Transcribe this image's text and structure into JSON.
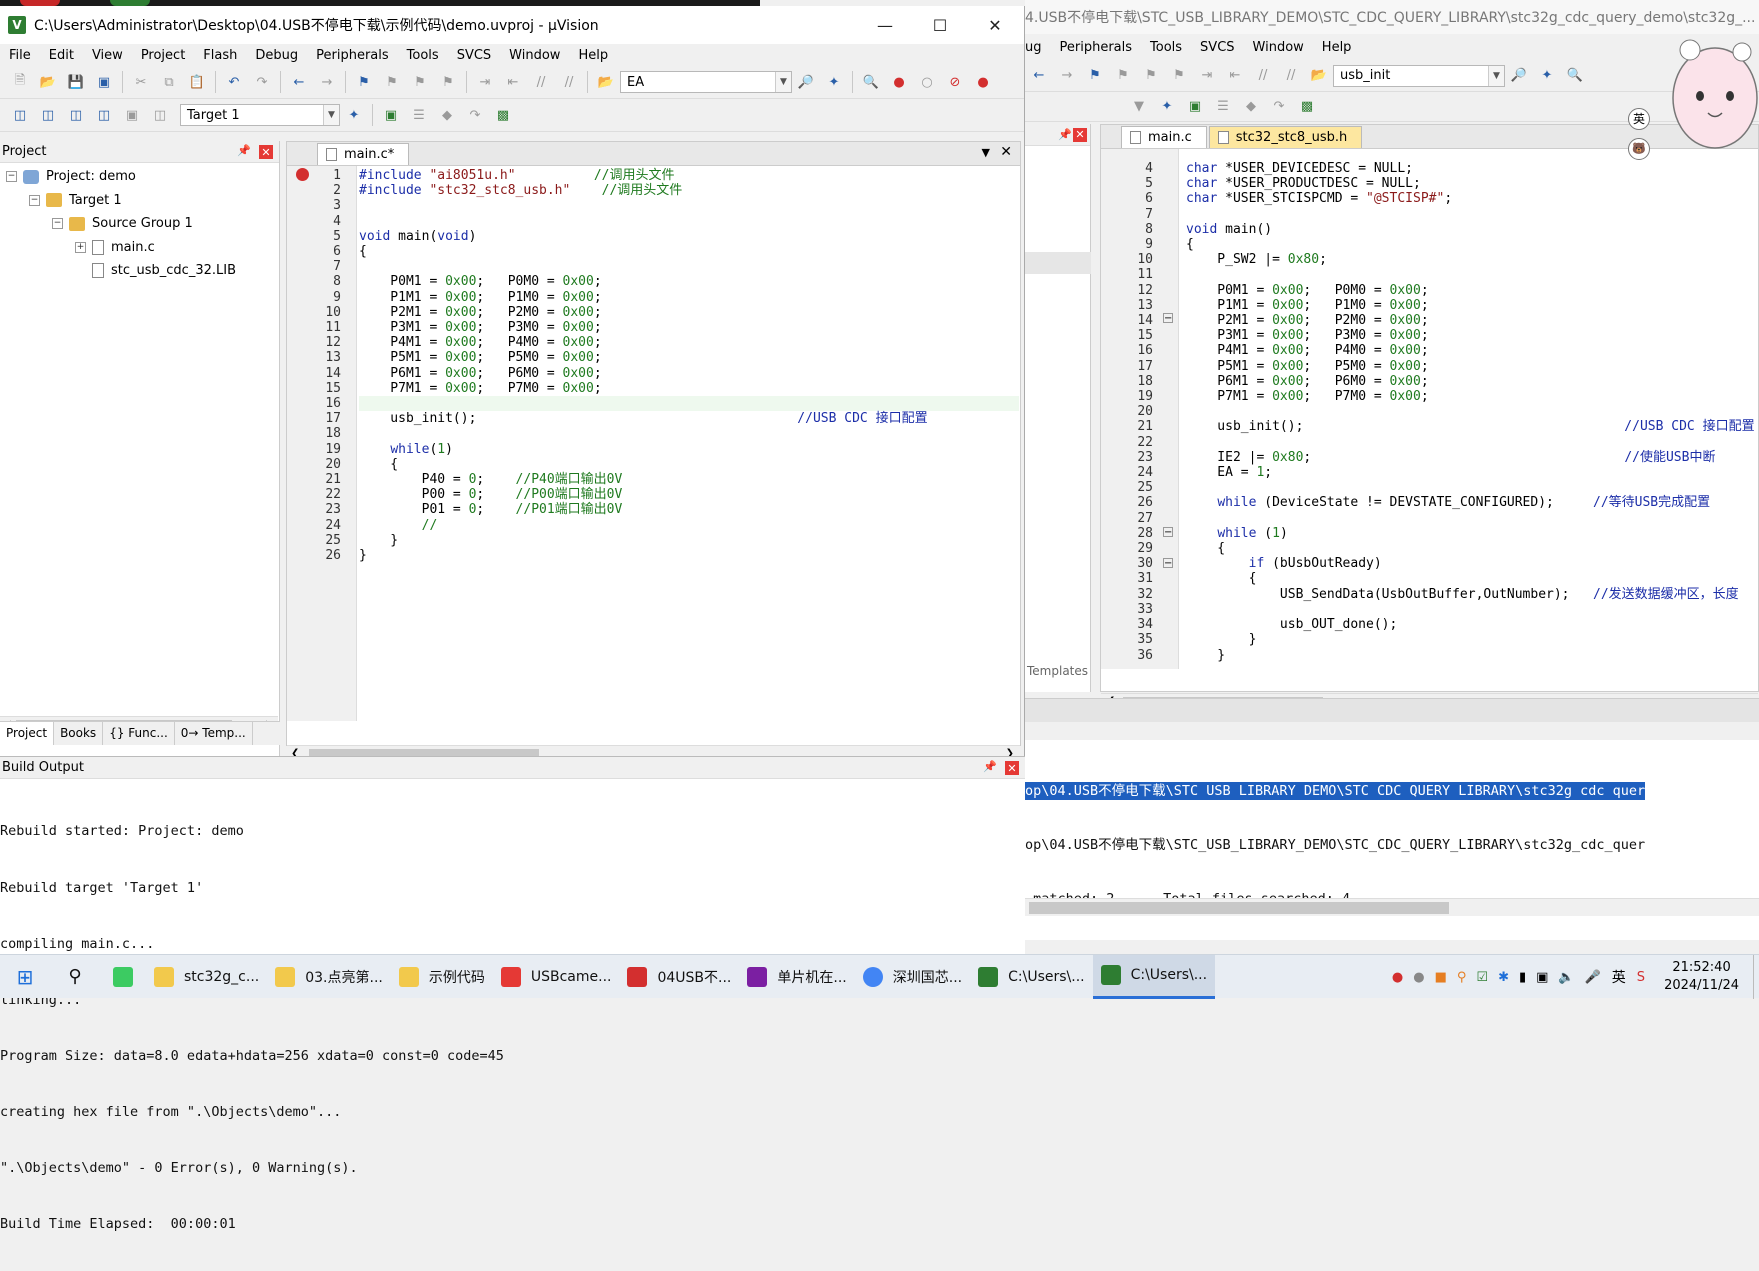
{
  "win1": {
    "title": "C:\\Users\\Administrator\\Desktop\\04.USB不停电下载\\示例代码\\demo.uvproj - µVision",
    "menu": [
      "File",
      "Edit",
      "View",
      "Project",
      "Flash",
      "Debug",
      "Peripherals",
      "Tools",
      "SVCS",
      "Window",
      "Help"
    ],
    "toolbar_combo": "EA",
    "target_combo": "Target 1",
    "project_panel": {
      "title": "Project",
      "tree": [
        {
          "label": "Project: demo",
          "depth": 0,
          "toggle": "−"
        },
        {
          "label": "Target 1",
          "depth": 1,
          "toggle": "−"
        },
        {
          "label": "Source Group 1",
          "depth": 2,
          "toggle": "−"
        },
        {
          "label": "main.c",
          "depth": 3,
          "toggle": "+"
        },
        {
          "label": "stc_usb_cdc_32.LIB",
          "depth": 3,
          "toggle": ""
        }
      ],
      "tabs": [
        "Project",
        "Books",
        "{} Func...",
        "0→ Temp..."
      ]
    },
    "editor_tab": "main.c*",
    "build_output": {
      "title": "Build Output",
      "lines": [
        "Rebuild started: Project: demo",
        "Rebuild target 'Target 1'",
        "compiling main.c...",
        "linking...",
        "Program Size: data=8.0 edata+hdata=256 xdata=0 const=0 code=45",
        "creating hex file from \".\\Objects\\demo\"...",
        "\".\\Objects\\demo\" - 0 Error(s), 0 Warning(s).",
        "Build Time Elapsed:  00:00:01"
      ]
    }
  },
  "win2": {
    "title": "4.USB不停电下载\\STC_USB_LIBRARY_DEMO\\STC_CDC_QUERY_LIBRARY\\stc32g_cdc_query_demo\\stc32g_...",
    "menu": [
      "ug",
      "Peripherals",
      "Tools",
      "SVCS",
      "Window",
      "Help"
    ],
    "toolbar_combo": "usb_init",
    "tabs": [
      "main.c",
      "stc32_stc8_usb.h"
    ],
    "templates_tab": "Templates",
    "ime_label": "英",
    "find_lines": [
      "op\\04.USB不停电下载\\STC USB LIBRARY DEMO\\STC CDC QUERY LIBRARY\\stc32g cdc quer",
      "op\\04.USB不停电下载\\STC_USB_LIBRARY_DEMO\\STC_CDC_QUERY_LIBRARY\\stc32g_cdc_quer",
      " matched: 2      Total files searched: 4"
    ]
  },
  "taskbar": {
    "items": [
      {
        "label": "stc32g_c...",
        "color": "#f2c94c"
      },
      {
        "label": "03.点亮第...",
        "color": "#f2c94c"
      },
      {
        "label": "示例代码",
        "color": "#f2c94c"
      },
      {
        "label": "USBcame...",
        "color": "#e53935"
      },
      {
        "label": "04USB不...",
        "color": "#d32f2f"
      },
      {
        "label": "单片机在...",
        "color": "#7b1fa2"
      },
      {
        "label": "深圳国芯...",
        "color": "#4285f4"
      },
      {
        "label": "C:\\Users\\...",
        "color": "#2e7d32"
      },
      {
        "label": "C:\\Users\\...",
        "color": "#2e7d32"
      }
    ],
    "ime": "英",
    "time": "21:52:40",
    "date": "2024/11/24"
  }
}
